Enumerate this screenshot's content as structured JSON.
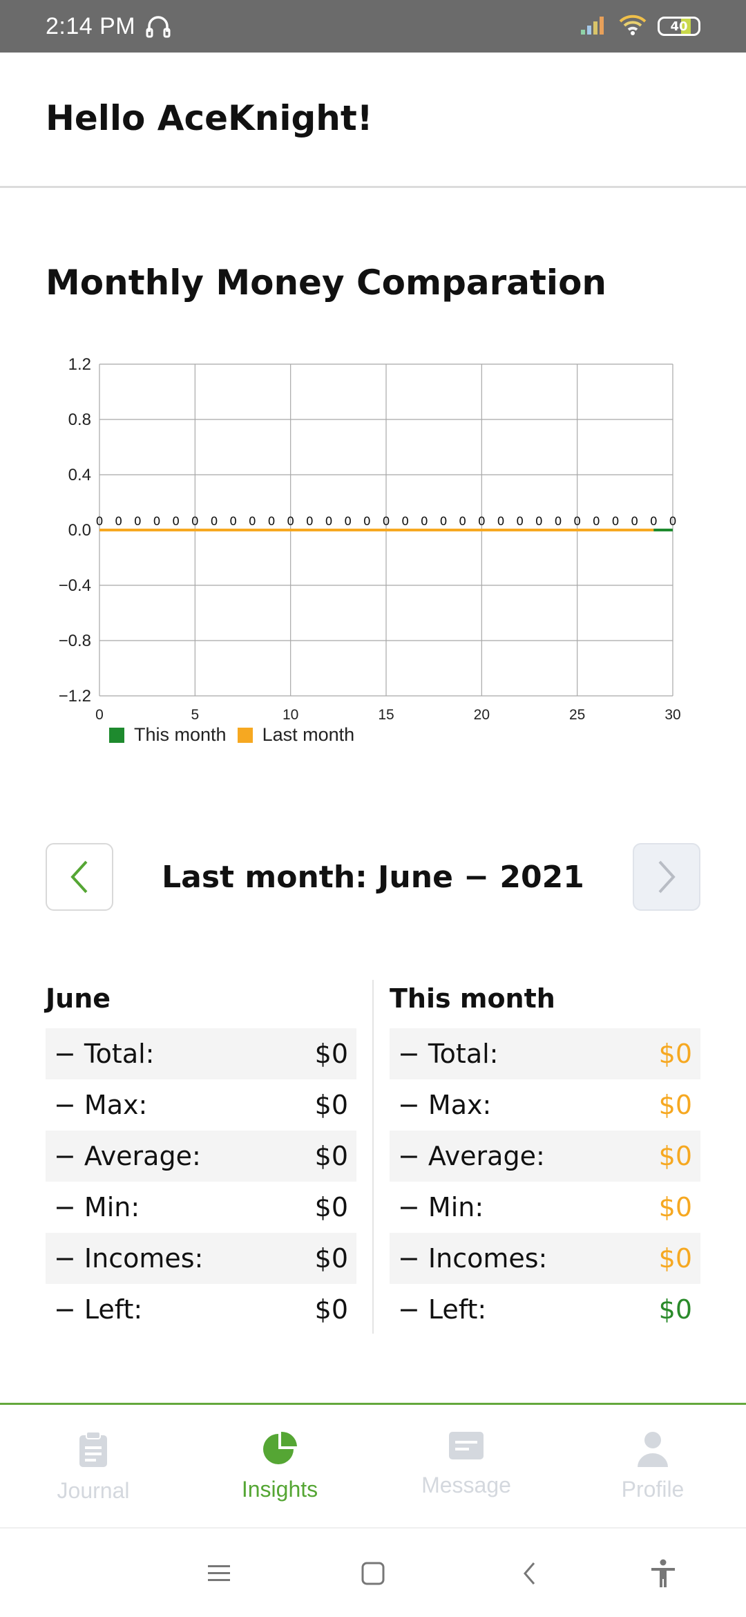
{
  "status_bar": {
    "time": "2:14 PM",
    "battery": "40"
  },
  "header": {
    "greeting": "Hello AceKnight!"
  },
  "section": {
    "title": "Monthly Money Comparation"
  },
  "chart_data": {
    "type": "line",
    "x": [
      0,
      1,
      2,
      3,
      4,
      5,
      6,
      7,
      8,
      9,
      10,
      11,
      12,
      13,
      14,
      15,
      16,
      17,
      18,
      19,
      20,
      21,
      22,
      23,
      24,
      25,
      26,
      27,
      28,
      29,
      30
    ],
    "series": [
      {
        "name": "This month",
        "values": [
          0,
          0,
          0,
          0,
          0,
          0,
          0,
          0,
          0,
          0,
          0,
          0,
          0,
          0,
          0,
          0,
          0,
          0,
          0,
          0,
          0,
          0,
          0,
          0,
          0,
          0,
          0,
          0,
          0,
          0,
          0
        ],
        "color": "#1e8a2e"
      },
      {
        "name": "Last month",
        "values": [
          0,
          0,
          0,
          0,
          0,
          0,
          0,
          0,
          0,
          0,
          0,
          0,
          0,
          0,
          0,
          0,
          0,
          0,
          0,
          0,
          0,
          0,
          0,
          0,
          0,
          0,
          0,
          0,
          0,
          0
        ],
        "color": "#f6a821"
      }
    ],
    "xticks": [
      0,
      5,
      10,
      15,
      20,
      25,
      30
    ],
    "yticks": [
      "1.2",
      "0.8",
      "0.4",
      "0.0",
      "−0.4",
      "−0.8",
      "−1.2"
    ],
    "xlim": [
      0,
      30
    ],
    "ylim": [
      -1.2,
      1.2
    ],
    "grid": true,
    "legend": "bottom-left",
    "point_label": "0"
  },
  "month_nav": {
    "label": "Last month: June − 2021"
  },
  "stats": {
    "left": {
      "title": "June",
      "rows": [
        {
          "label": "− Total:",
          "value": "$0"
        },
        {
          "label": "− Max:",
          "value": "$0"
        },
        {
          "label": "− Average:",
          "value": "$0"
        },
        {
          "label": "− Min:",
          "value": "$0"
        },
        {
          "label": "− Incomes:",
          "value": "$0"
        },
        {
          "label": "− Left:",
          "value": "$0"
        }
      ]
    },
    "right": {
      "title": "This month",
      "rows": [
        {
          "label": "− Total:",
          "value": "$0"
        },
        {
          "label": "− Max:",
          "value": "$0"
        },
        {
          "label": "− Average:",
          "value": "$0"
        },
        {
          "label": "− Min:",
          "value": "$0"
        },
        {
          "label": "− Incomes:",
          "value": "$0"
        },
        {
          "label": "− Left:",
          "value": "$0"
        }
      ]
    }
  },
  "bottom_nav": {
    "tabs": [
      {
        "label": "Journal",
        "icon": "clipboard-icon",
        "active": false
      },
      {
        "label": "Insights",
        "icon": "pie-chart-icon",
        "active": true
      },
      {
        "label": "Message",
        "icon": "message-icon",
        "active": false
      },
      {
        "label": "Profile",
        "icon": "user-icon",
        "active": false
      }
    ]
  },
  "colors": {
    "accent": "#55a634",
    "orange": "#f6a821",
    "green": "#2a8a2a"
  }
}
